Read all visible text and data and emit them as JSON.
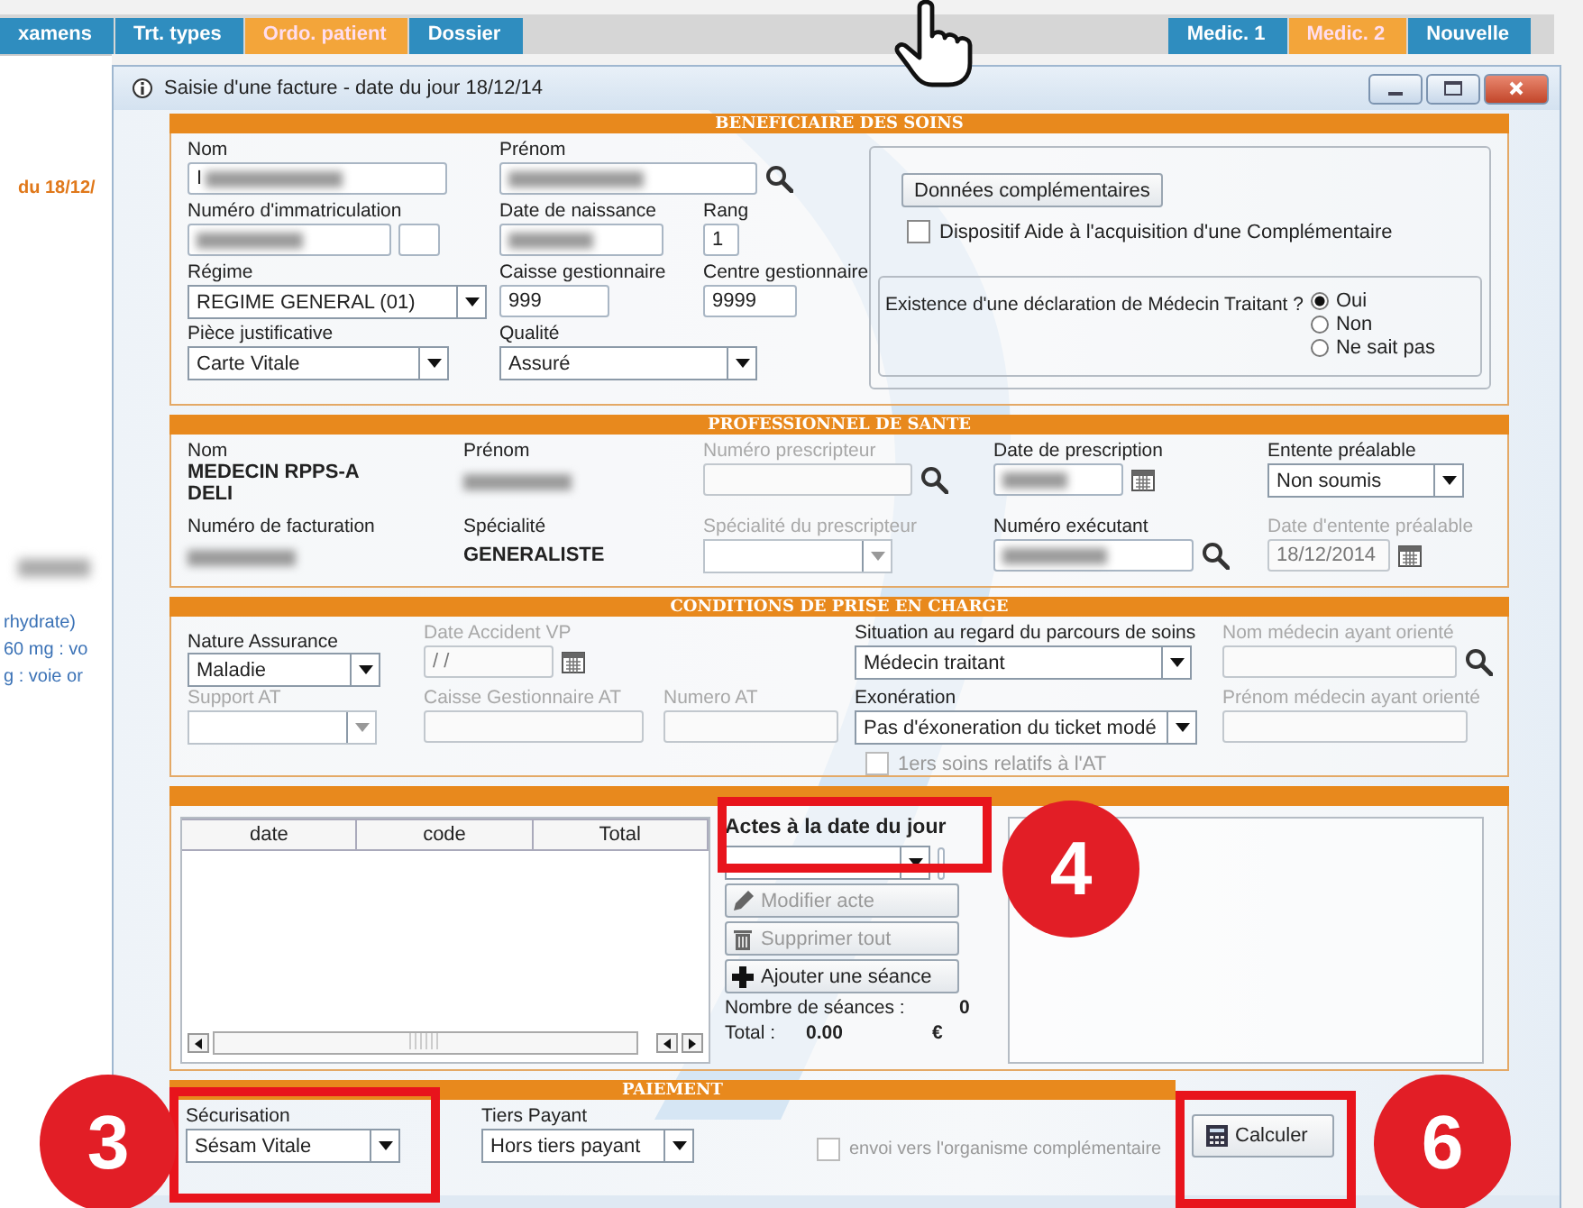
{
  "app_tabs_left": [
    {
      "label": "xamens",
      "selected": false
    },
    {
      "label": "Trt. types",
      "selected": false
    },
    {
      "label": "Ordo. patient",
      "selected": true
    },
    {
      "label": "Dossier",
      "selected": false
    }
  ],
  "app_tabs_right": [
    {
      "label": "Medic. 1",
      "selected": false
    },
    {
      "label": "Medic. 2",
      "selected": true
    },
    {
      "label": "Nouvelle",
      "selected": false
    }
  ],
  "side_texts": [
    {
      "kind": "date",
      "text": "du 18/12/"
    },
    {
      "kind": "blur"
    },
    {
      "kind": "note",
      "text": "rhydrate)"
    },
    {
      "kind": "note",
      "text": "60 mg : vo"
    },
    {
      "kind": "note",
      "text": "g : voie or"
    }
  ],
  "window": {
    "title": "Saisie d'une facture - date du jour 18/12/14"
  },
  "sections": [
    {
      "kind": "beneficiary",
      "title": "BENEFICIAIRE DES SOINS",
      "fields": [
        {
          "kind": "field",
          "label": "Nom",
          "value": "I",
          "blurred": true,
          "disabled": false
        },
        {
          "kind": "field",
          "label": "Prénom",
          "blurred": true,
          "disabled": false,
          "search": true
        },
        {
          "kind": "split-field",
          "label": "Numéro d'immatriculation",
          "blurred": true,
          "disabled": false
        },
        {
          "kind": "field",
          "label": "Date de naissance",
          "blurred": true,
          "disabled": false
        },
        {
          "kind": "field",
          "label": "Rang",
          "value": "1",
          "blurred": false,
          "disabled": false
        },
        {
          "kind": "select",
          "label": "Régime",
          "value": "REGIME GENERAL (01)",
          "disabled": false
        },
        {
          "kind": "field",
          "label": "Caisse gestionnaire",
          "value": "999",
          "blurred": false,
          "disabled": false
        },
        {
          "kind": "field",
          "label": "Centre gestionnaire",
          "value": "9999",
          "blurred": false,
          "disabled": false
        },
        {
          "kind": "select",
          "label": "Pièce justificative",
          "value": "Carte Vitale",
          "disabled": false
        },
        {
          "kind": "select",
          "label": "Qualité",
          "value": "Assuré",
          "disabled": false
        }
      ],
      "panel": {
        "button": "Données complémentaires",
        "checkbox": {
          "label": "Dispositif Aide à l'acquisition d'une Complémentaire",
          "checked": false,
          "disabled": false
        },
        "question": "Existence d'une déclaration de Médecin Traitant ?",
        "options": [
          {
            "label": "Oui",
            "selected": true
          },
          {
            "label": "Non",
            "selected": false
          },
          {
            "label": "Ne sait pas",
            "selected": false
          }
        ]
      }
    },
    {
      "kind": "professional",
      "title": "PROFESSIONNEL DE SANTE",
      "fields": [
        {
          "kind": "text",
          "label": "Nom",
          "lines": [
            "MEDECIN RPPS-A",
            "DELI"
          ],
          "disabled": false
        },
        {
          "kind": "text",
          "label": "Prénom",
          "blurred": true,
          "disabled": false
        },
        {
          "kind": "field",
          "label": "Numéro prescripteur",
          "blurred": false,
          "disabled": true,
          "search": true
        },
        {
          "kind": "field",
          "label": "Date de prescription",
          "blurred": true,
          "disabled": false,
          "calendar": true
        },
        {
          "kind": "select",
          "label": "Entente préalable",
          "value": "Non soumis",
          "disabled": false
        },
        {
          "kind": "text",
          "label": "Numéro de facturation",
          "blurred": true,
          "disabled": false
        },
        {
          "kind": "text",
          "label": "Spécialité",
          "lines": [
            "GENERALISTE"
          ],
          "disabled": false
        },
        {
          "kind": "select",
          "label": "Spécialité du prescripteur",
          "disabled": true
        },
        {
          "kind": "field",
          "label": "Numéro exécutant",
          "blurred": true,
          "disabled": false,
          "search": true
        },
        {
          "kind": "field",
          "label": "Date d'entente préalable",
          "value": "18/12/2014",
          "blurred": false,
          "disabled": true,
          "calendar": true
        }
      ]
    },
    {
      "kind": "conditions",
      "title": "CONDITIONS DE PRISE EN CHARGE",
      "fields": [
        {
          "kind": "select",
          "label": "Nature Assurance",
          "value": "Maladie",
          "disabled": false
        },
        {
          "kind": "field",
          "label": "Date Accident VP",
          "value": "/ /",
          "blurred": false,
          "disabled": true,
          "calendar": true
        },
        {
          "kind": "select",
          "label": "Situation au regard du parcours de soins",
          "value": "Médecin traitant",
          "disabled": false
        },
        {
          "kind": "field",
          "label": "Nom médecin ayant orienté",
          "blurred": false,
          "disabled": true,
          "search": true
        },
        {
          "kind": "select",
          "label": "Support AT",
          "disabled": true
        },
        {
          "kind": "field",
          "label": "Caisse Gestionnaire AT",
          "blurred": false,
          "disabled": true
        },
        {
          "kind": "field",
          "label": "Numero AT",
          "blurred": false,
          "disabled": true
        },
        {
          "kind": "select",
          "label": "Exonération",
          "value": "Pas d'éxoneration du ticket modé",
          "disabled": false
        },
        {
          "kind": "field",
          "label": "Prénom médecin ayant orienté",
          "blurred": false,
          "disabled": true
        },
        {
          "kind": "checkbox",
          "label": "1ers soins relatifs à l'AT",
          "checked": false,
          "disabled": true
        }
      ]
    },
    {
      "kind": "acts",
      "table": {
        "columns": [
          "date",
          "code",
          "Total"
        ]
      },
      "acts_label": "Actes à la date du jour",
      "buttons": [
        {
          "kind": "edit",
          "label": "Modifier acte",
          "disabled": true
        },
        {
          "kind": "delete",
          "label": "Supprimer tout",
          "disabled": true
        },
        {
          "kind": "add",
          "label": "Ajouter une séance",
          "disabled": false
        }
      ],
      "count_label": "Nombre de séances :",
      "count": "0",
      "total_label": "Total :",
      "total": "0.00",
      "currency": "€"
    },
    {
      "kind": "payment",
      "title": "PAIEMENT",
      "fields": [
        {
          "kind": "select",
          "label": "Sécurisation",
          "value": "Sésam Vitale",
          "disabled": false
        },
        {
          "kind": "select",
          "label": "Tiers Payant",
          "value": "Hors tiers payant",
          "disabled": false
        },
        {
          "kind": "checkbox",
          "label": "envoi vers l'organisme complémentaire",
          "checked": false,
          "disabled": true
        }
      ],
      "button": "Calculer"
    }
  ],
  "annotations": [
    {
      "number": "4"
    },
    {
      "number": "3"
    },
    {
      "number": "6"
    }
  ]
}
